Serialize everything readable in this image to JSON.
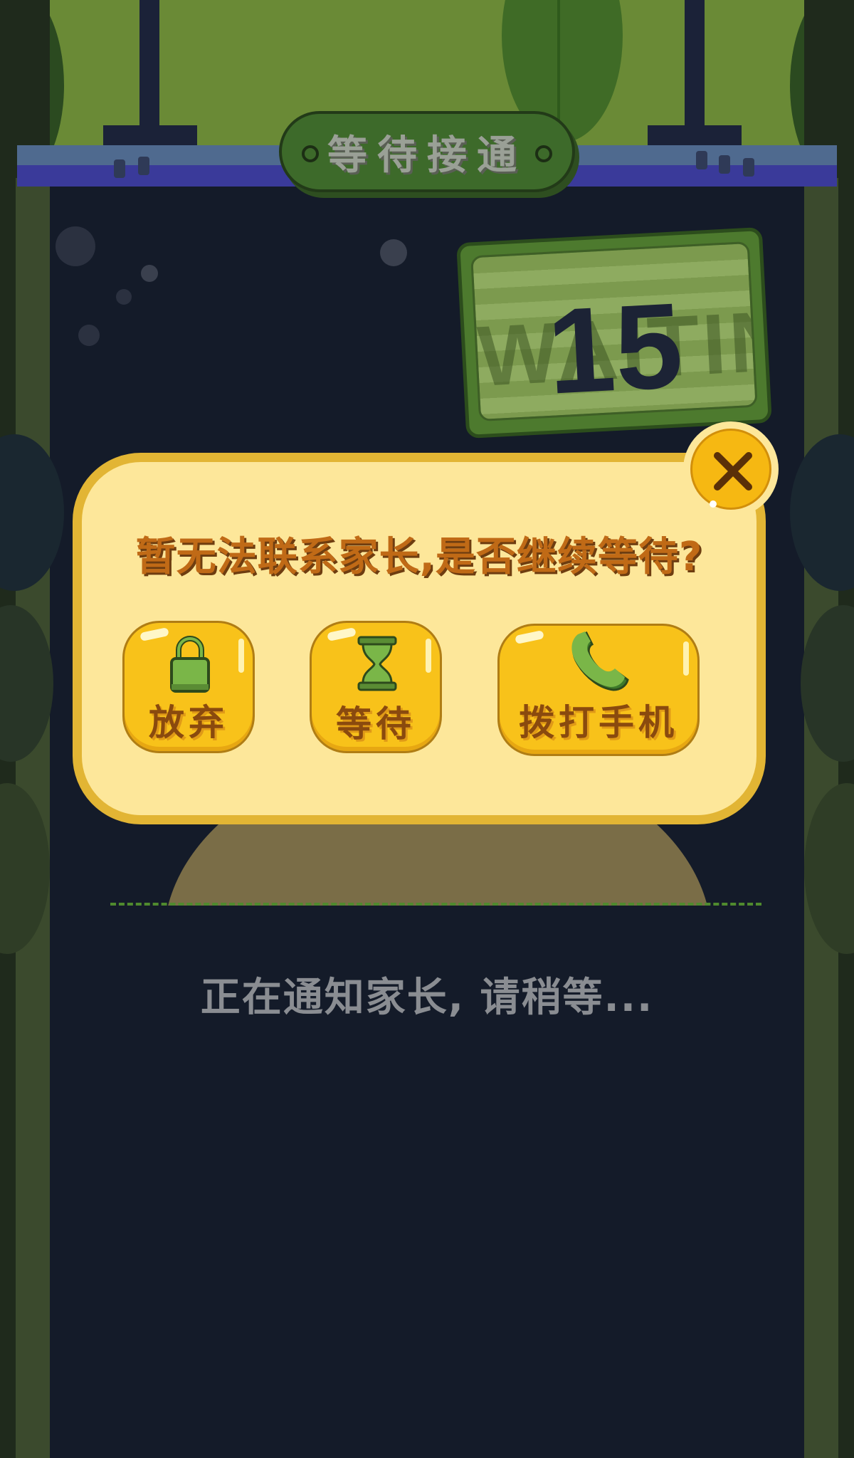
{
  "header": {
    "title": "等待接通"
  },
  "waiting_sign": {
    "watermark": "WAITING",
    "countdown": "15"
  },
  "dialog": {
    "message": "暂无法联系家长,是否继续等待?",
    "buttons": [
      {
        "label": "放弃",
        "icon": "lock-icon"
      },
      {
        "label": "等待",
        "icon": "hourglass-icon"
      },
      {
        "label": "拨打手机",
        "icon": "phone-icon"
      }
    ],
    "close_icon": "close-icon"
  },
  "status": {
    "text": "正在通知家长, 请稍等..."
  },
  "colors": {
    "background": "#141b29",
    "jungle_green": "#6a8a36",
    "dialog_fill": "#fde79a",
    "dialog_border": "#e2b534",
    "button_yellow": "#f8c21a",
    "icon_green": "#7ab648",
    "text_brown": "#c06a16",
    "status_gray": "#8a8d92"
  }
}
